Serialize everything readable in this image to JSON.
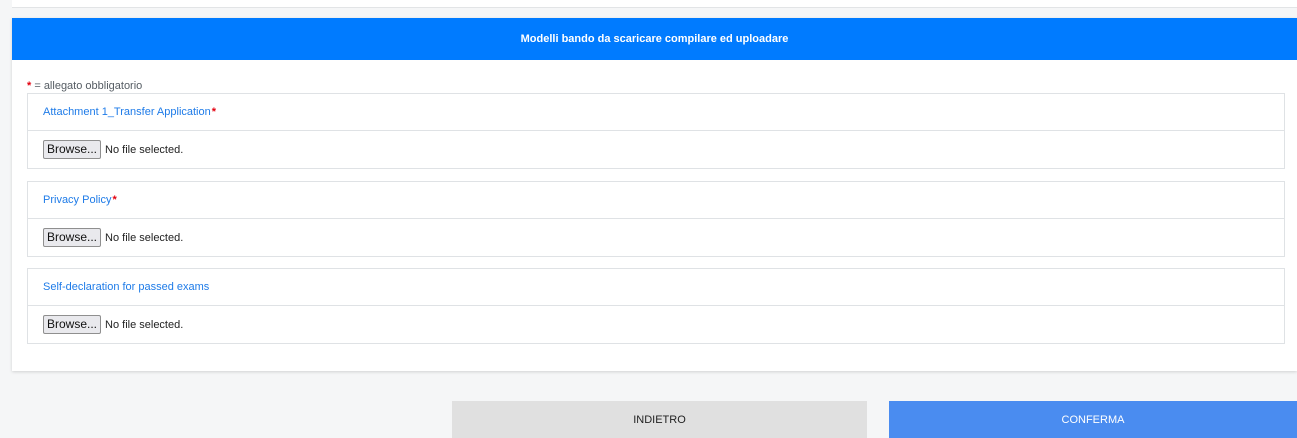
{
  "header": {
    "title": "Modelli bando da scaricare compilare ed uploadare"
  },
  "legend": {
    "star": "*",
    "text": " = allegato obbligatorio"
  },
  "attachments": [
    {
      "label": "Attachment 1_Transfer Application",
      "required_mark": "*",
      "browse_label": "Browse...",
      "status": "No file selected."
    },
    {
      "label": "Privacy Policy",
      "required_mark": "*",
      "browse_label": "Browse...",
      "status": "No file selected."
    },
    {
      "label": "Self-declaration for passed exams",
      "required_mark": "",
      "browse_label": "Browse...",
      "status": "No file selected."
    }
  ],
  "actions": {
    "back_label": "INDIETRO",
    "confirm_label": "CONFERMA"
  },
  "colors": {
    "header_bg": "#007bff",
    "label_blue": "#1e7be8",
    "required_red": "#e3000f",
    "confirm_bg": "#4a8cf0",
    "back_bg": "#e0e0e0"
  }
}
